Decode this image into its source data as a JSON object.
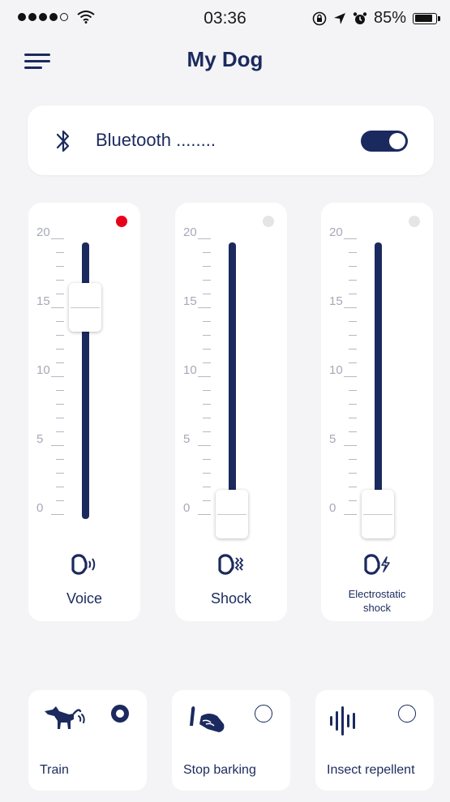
{
  "status_bar": {
    "time": "03:36",
    "battery": "85%",
    "battery_level": 0.85,
    "signal_bars_filled": 4,
    "signal_bars_total": 5
  },
  "header": {
    "title": "My Dog",
    "menu_icon": "hamburger-menu-icon"
  },
  "bluetooth": {
    "label": "Bluetooth ........",
    "icon": "bluetooth-icon",
    "enabled": true
  },
  "scale": {
    "max": 20,
    "labels": [
      "20",
      "15",
      "10",
      "5",
      "0"
    ]
  },
  "sliders": [
    {
      "label": "Voice",
      "value": 15,
      "active": true,
      "icon": "voice-icon"
    },
    {
      "label": "Shock",
      "value": 0,
      "active": false,
      "icon": "vibration-icon"
    },
    {
      "label": "Electrostatic shock",
      "label_line1": "Electrostatic",
      "label_line2": "shock",
      "value": 0,
      "active": false,
      "icon": "electrostatic-icon"
    }
  ],
  "modes": [
    {
      "label": "Train",
      "selected": true,
      "icon": "dog-icon"
    },
    {
      "label": "Stop barking",
      "selected": false,
      "icon": "hand-icon"
    },
    {
      "label": "Insect repellent",
      "selected": false,
      "icon": "sound-wave-icon"
    }
  ],
  "colors": {
    "accent": "#1b2a5e",
    "indicator_on": "#e8001a",
    "background": "#f4f4f6"
  }
}
